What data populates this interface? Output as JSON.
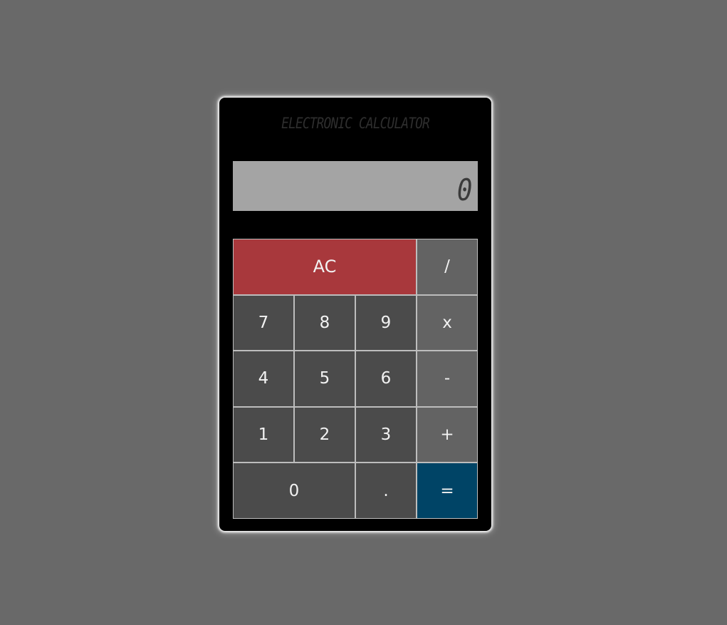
{
  "calculator": {
    "title": "ELECTRONIC CALCULATOR",
    "display": "0",
    "keys": {
      "ac": "AC",
      "divide": "/",
      "seven": "7",
      "eight": "8",
      "nine": "9",
      "multiply": "x",
      "four": "4",
      "five": "5",
      "six": "6",
      "subtract": "-",
      "one": "1",
      "two": "2",
      "three": "3",
      "add": "+",
      "zero": "0",
      "decimal": ".",
      "equals": "="
    }
  },
  "colors": {
    "background": "#696969",
    "body": "#000000",
    "display": "#a4a4a4",
    "ac_key": "#a8383c",
    "number_key": "#4b4b4b",
    "operator_key": "#636363",
    "equals_key": "#004466"
  }
}
